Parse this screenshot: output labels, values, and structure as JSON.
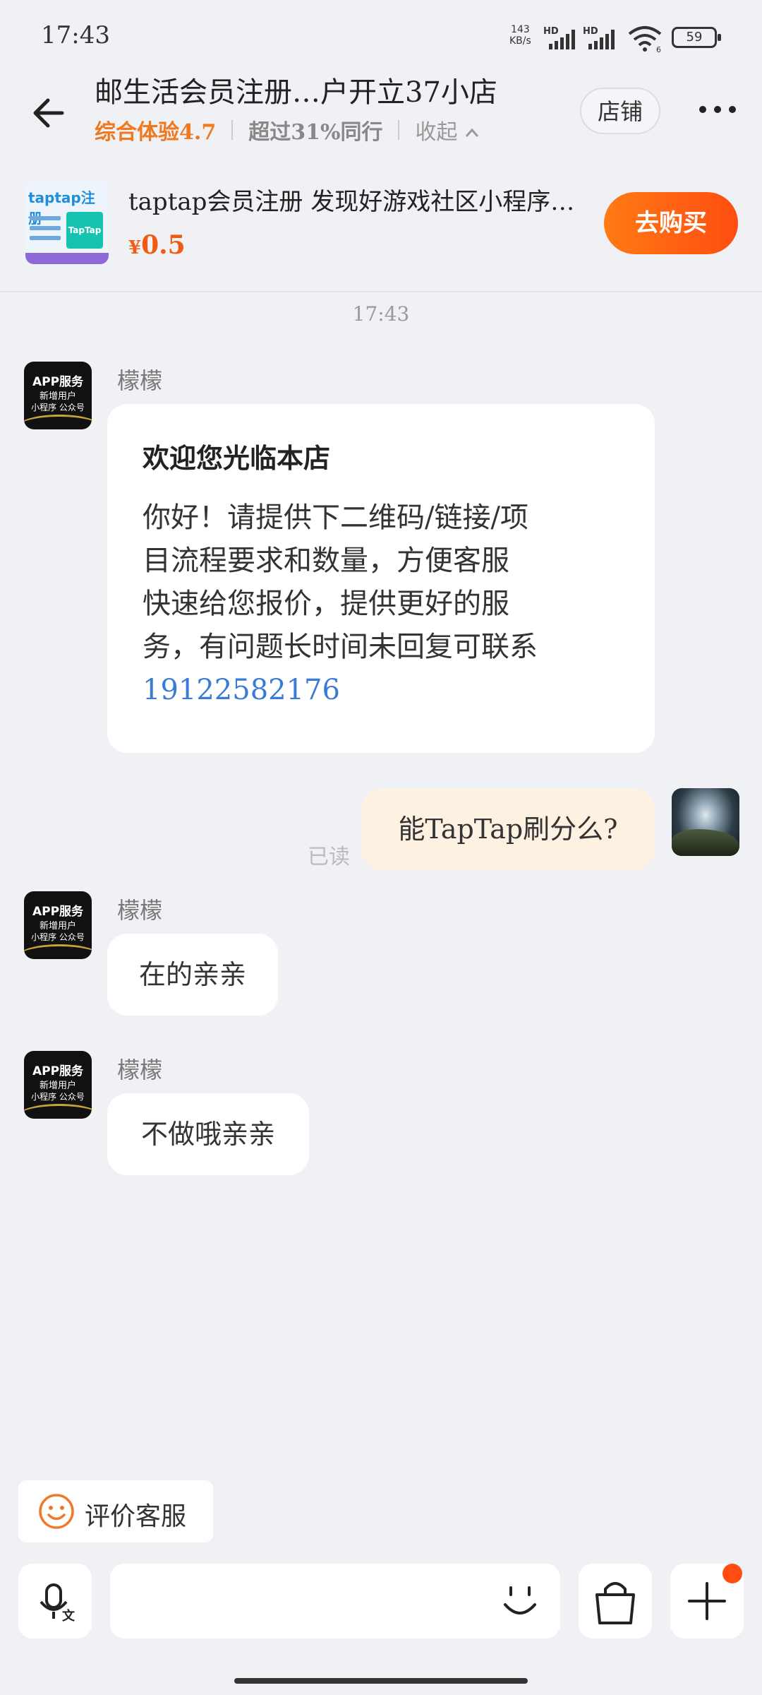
{
  "status_bar": {
    "time": "17:43",
    "speed_value": "143",
    "speed_unit": "KB/s",
    "hd_label": "HD",
    "wifi_sub": "6",
    "battery": "59"
  },
  "header": {
    "title": "邮生活会员注册…户开立37小店",
    "rating": "综合体验4.7",
    "exceed": "超过31%同行",
    "collapse": "收起",
    "store_button": "店铺"
  },
  "product": {
    "thumb_title": "taptap注册",
    "thumb_logo": "TapTap",
    "title": "taptap会员注册 发现好游戏社区小程序…",
    "price_symbol": "¥",
    "price": "0.5",
    "buy_button": "去购买"
  },
  "chat": {
    "timestamp": "17:43",
    "shop_avatar": {
      "line1": "APP服务",
      "line2": "新增用户",
      "line3": "小程序 公众号"
    },
    "sender_name": "檬檬",
    "welcome_title": "欢迎您光临本店",
    "welcome_lines": [
      "你好！请提供下二维码/链接/项",
      "目流程要求和数量，方便客服",
      "快速给您报价，提供更好的服",
      "务，有问题长时间未回复可联系"
    ],
    "phone": "19122582176",
    "my_message": "能TapTap刷分么?",
    "read_label": "已读",
    "reply1": "在的亲亲",
    "reply2": "不做哦亲亲"
  },
  "bottom": {
    "evaluate_label": "评价客服"
  }
}
